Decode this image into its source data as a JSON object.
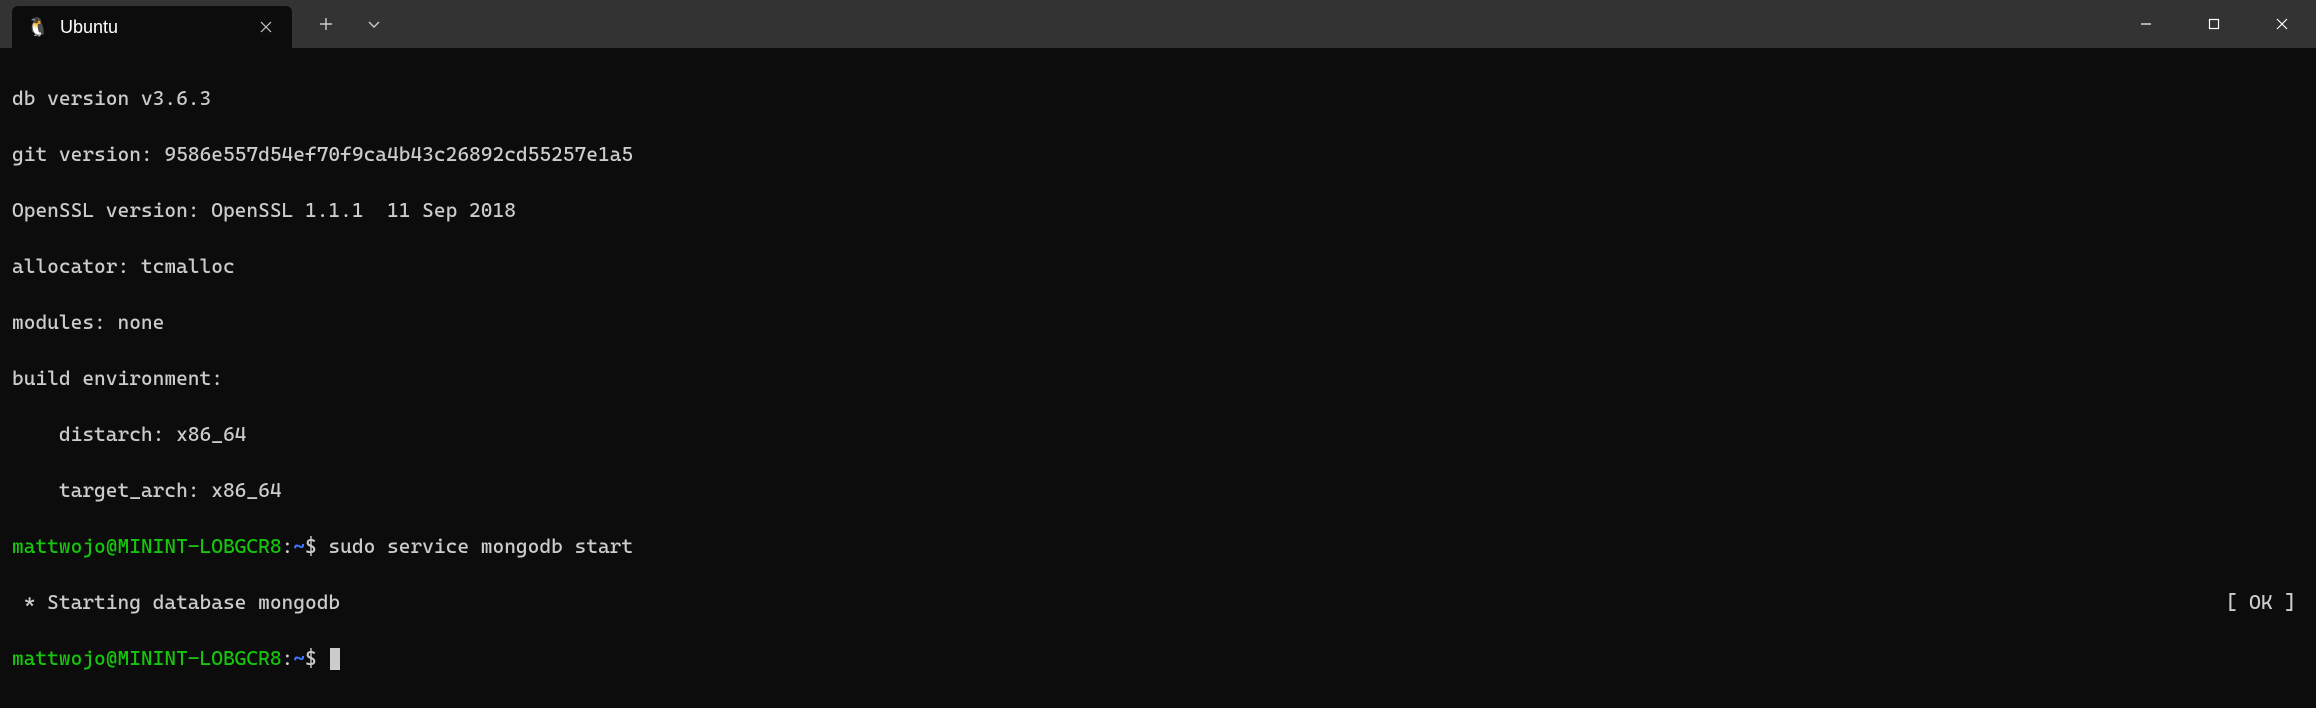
{
  "titlebar": {
    "tab": {
      "icon": "🐧",
      "title": "Ubuntu",
      "close": "✕"
    },
    "new_tab": "+",
    "dropdown": "⌄",
    "minimize": "—",
    "maximize": "☐",
    "close": "✕"
  },
  "terminal": {
    "lines": [
      "db version v3.6.3",
      "git version: 9586e557d54ef70f9ca4b43c26892cd55257e1a5",
      "OpenSSL version: OpenSSL 1.1.1  11 Sep 2018",
      "allocator: tcmalloc",
      "modules: none",
      "build environment:",
      "    distarch: x86_64",
      "    target_arch: x86_64"
    ],
    "prompt1": {
      "user_host": "mattwojo@MININT-LOBGCR8",
      "sep": ":",
      "path": "~",
      "dollar": "$",
      "command": "sudo service mongodb start"
    },
    "status": {
      "msg": " * Starting database mongodb",
      "ok": "[ OK ]"
    },
    "prompt2": {
      "user_host": "mattwojo@MININT-LOBGCR8",
      "sep": ":",
      "path": "~",
      "dollar": "$",
      "command": ""
    }
  }
}
